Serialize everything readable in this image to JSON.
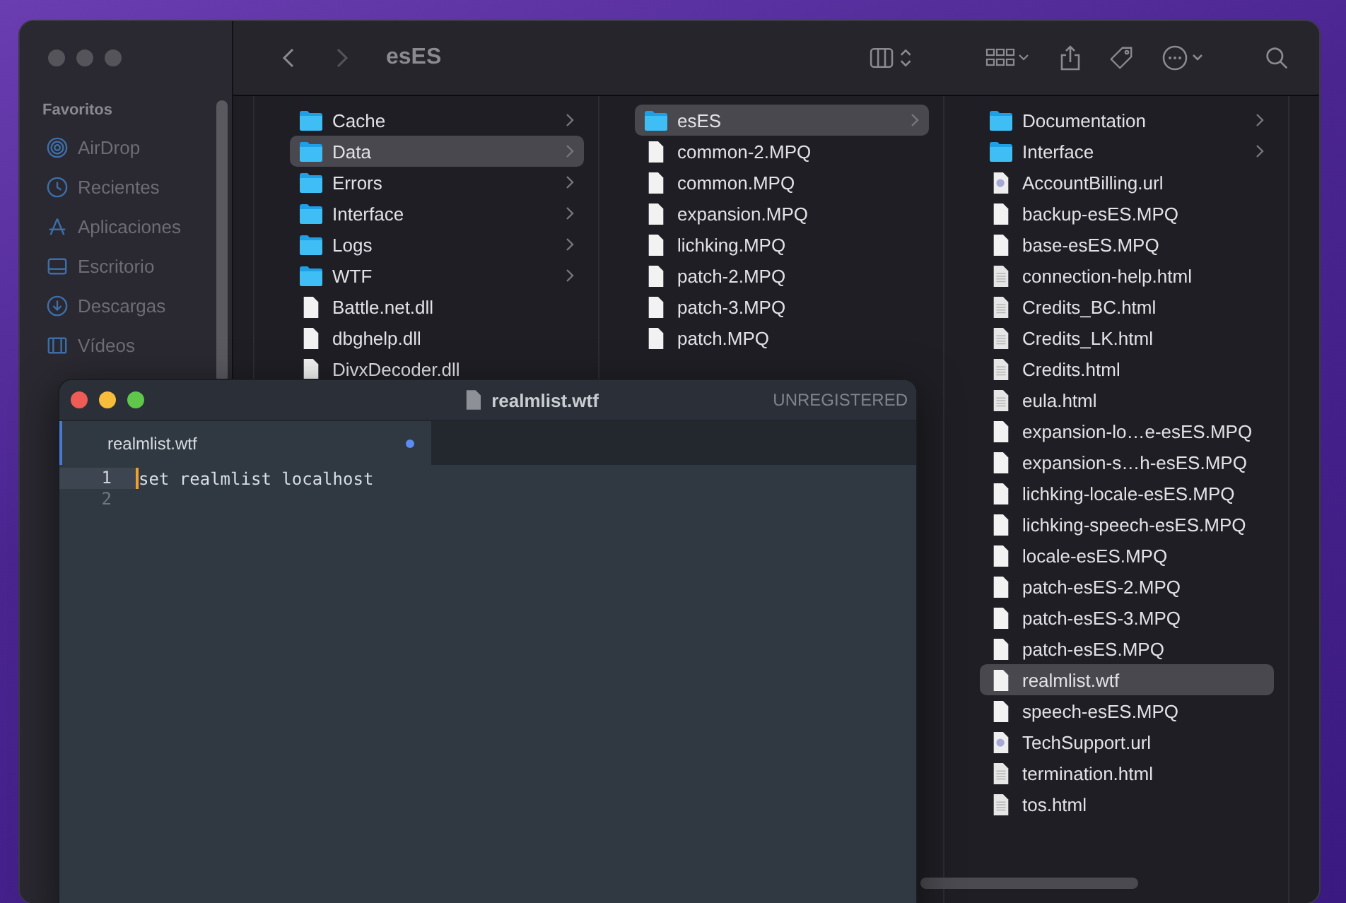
{
  "finder": {
    "path_title": "esES",
    "sidebar": {
      "section": "Favoritos",
      "items": [
        {
          "label": "AirDrop",
          "kind": "airdrop"
        },
        {
          "label": "Recientes",
          "kind": "clock"
        },
        {
          "label": "Aplicaciones",
          "kind": "apps"
        },
        {
          "label": "Escritorio",
          "kind": "desktop"
        },
        {
          "label": "Descargas",
          "kind": "download"
        },
        {
          "label": "Vídeos",
          "kind": "film"
        }
      ]
    },
    "columns": [
      {
        "items": [
          {
            "name": "Cache",
            "kind": "folder",
            "selected": false
          },
          {
            "name": "Data",
            "kind": "folder",
            "selected": true
          },
          {
            "name": "Errors",
            "kind": "folder",
            "selected": false
          },
          {
            "name": "Interface",
            "kind": "folder",
            "selected": false
          },
          {
            "name": "Logs",
            "kind": "folder",
            "selected": false
          },
          {
            "name": "WTF",
            "kind": "folder",
            "selected": false
          },
          {
            "name": "Battle.net.dll",
            "kind": "file",
            "selected": false
          },
          {
            "name": "dbghelp.dll",
            "kind": "file",
            "selected": false
          },
          {
            "name": "DivxDecoder.dll",
            "kind": "file",
            "selected": false
          }
        ]
      },
      {
        "items": [
          {
            "name": "esES",
            "kind": "folder",
            "selected": true
          },
          {
            "name": "common-2.MPQ",
            "kind": "file",
            "selected": false
          },
          {
            "name": "common.MPQ",
            "kind": "file",
            "selected": false
          },
          {
            "name": "expansion.MPQ",
            "kind": "file",
            "selected": false
          },
          {
            "name": "lichking.MPQ",
            "kind": "file",
            "selected": false
          },
          {
            "name": "patch-2.MPQ",
            "kind": "file",
            "selected": false
          },
          {
            "name": "patch-3.MPQ",
            "kind": "file",
            "selected": false
          },
          {
            "name": "patch.MPQ",
            "kind": "file",
            "selected": false
          }
        ]
      },
      {
        "items": [
          {
            "name": "Documentation",
            "kind": "folder",
            "selected": false
          },
          {
            "name": "Interface",
            "kind": "folder",
            "selected": false
          },
          {
            "name": "AccountBilling.url",
            "kind": "url",
            "selected": false
          },
          {
            "name": "backup-esES.MPQ",
            "kind": "file",
            "selected": false
          },
          {
            "name": "base-esES.MPQ",
            "kind": "file",
            "selected": false
          },
          {
            "name": "connection-help.html",
            "kind": "html",
            "selected": false
          },
          {
            "name": "Credits_BC.html",
            "kind": "html",
            "selected": false
          },
          {
            "name": "Credits_LK.html",
            "kind": "html",
            "selected": false
          },
          {
            "name": "Credits.html",
            "kind": "html",
            "selected": false
          },
          {
            "name": "eula.html",
            "kind": "html",
            "selected": false
          },
          {
            "name": "expansion-lo…e-esES.MPQ",
            "kind": "file",
            "selected": false
          },
          {
            "name": "expansion-s…h-esES.MPQ",
            "kind": "file",
            "selected": false
          },
          {
            "name": "lichking-locale-esES.MPQ",
            "kind": "file",
            "selected": false
          },
          {
            "name": "lichking-speech-esES.MPQ",
            "kind": "file",
            "selected": false
          },
          {
            "name": "locale-esES.MPQ",
            "kind": "file",
            "selected": false
          },
          {
            "name": "patch-esES-2.MPQ",
            "kind": "file",
            "selected": false
          },
          {
            "name": "patch-esES-3.MPQ",
            "kind": "file",
            "selected": false
          },
          {
            "name": "patch-esES.MPQ",
            "kind": "file",
            "selected": false
          },
          {
            "name": "realmlist.wtf",
            "kind": "file",
            "selected": true
          },
          {
            "name": "speech-esES.MPQ",
            "kind": "file",
            "selected": false
          },
          {
            "name": "TechSupport.url",
            "kind": "url",
            "selected": false
          },
          {
            "name": "termination.html",
            "kind": "html",
            "selected": false
          },
          {
            "name": "tos.html",
            "kind": "html",
            "selected": false
          }
        ]
      }
    ]
  },
  "editor": {
    "title": "realmlist.wtf",
    "license": "UNREGISTERED",
    "tabs": [
      {
        "label": "realmlist.wtf",
        "selected": true,
        "modified": true
      }
    ],
    "lines": [
      {
        "number": "1",
        "text": "set realmlist localhost",
        "current": true
      },
      {
        "number": "2",
        "current": false
      }
    ]
  }
}
